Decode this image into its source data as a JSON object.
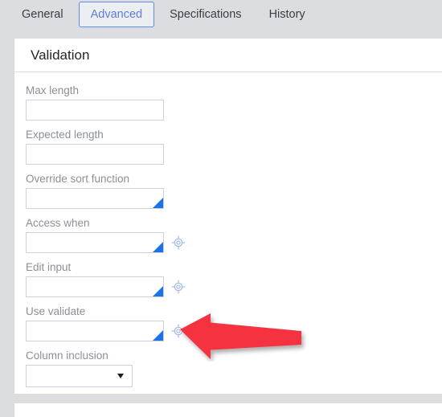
{
  "tabs": [
    {
      "label": "General",
      "active": false
    },
    {
      "label": "Advanced",
      "active": true
    },
    {
      "label": "Specifications",
      "active": false
    },
    {
      "label": "History",
      "active": false
    }
  ],
  "panel": {
    "title": "Validation"
  },
  "fields": [
    {
      "label": "Max length",
      "type": "text",
      "value": "",
      "placeholder": "",
      "resize": false,
      "picker": false
    },
    {
      "label": "Expected length",
      "type": "text",
      "value": "",
      "placeholder": "",
      "resize": false,
      "picker": false
    },
    {
      "label": "Override sort function",
      "type": "textarea",
      "value": "",
      "placeholder": "",
      "resize": true,
      "picker": false
    },
    {
      "label": "Access when",
      "type": "textarea",
      "value": "",
      "placeholder": "",
      "resize": true,
      "picker": true
    },
    {
      "label": "Edit input",
      "type": "textarea",
      "value": "",
      "placeholder": "",
      "resize": true,
      "picker": true
    },
    {
      "label": "Use validate",
      "type": "textarea",
      "value": "",
      "placeholder": "",
      "resize": true,
      "picker": true
    },
    {
      "label": "Column inclusion",
      "type": "select",
      "value": "",
      "placeholder": "",
      "resize": false,
      "picker": false
    }
  ],
  "icons": {
    "picker": "crosshair-target-icon",
    "select_arrow": "chevron-down-icon",
    "resize_grip": "resize-handle-icon"
  },
  "annotation": {
    "name": "red-arrow-pointer",
    "direction": "left",
    "points_at": "Use validate"
  },
  "colors": {
    "page_bg": "#dcdde1",
    "panel_bg": "#ffffff",
    "tab_active_text": "#5b7fdb",
    "tab_active_border": "#5b8cf0",
    "tab_text": "#3c3c46",
    "label_text": "#8a8f99",
    "input_border": "#cfd2d8",
    "resize_grip": "#1a73e8",
    "picker_icon": "#9fb6e8",
    "annotation_red": "#f5333f",
    "header_text": "#23252b"
  }
}
